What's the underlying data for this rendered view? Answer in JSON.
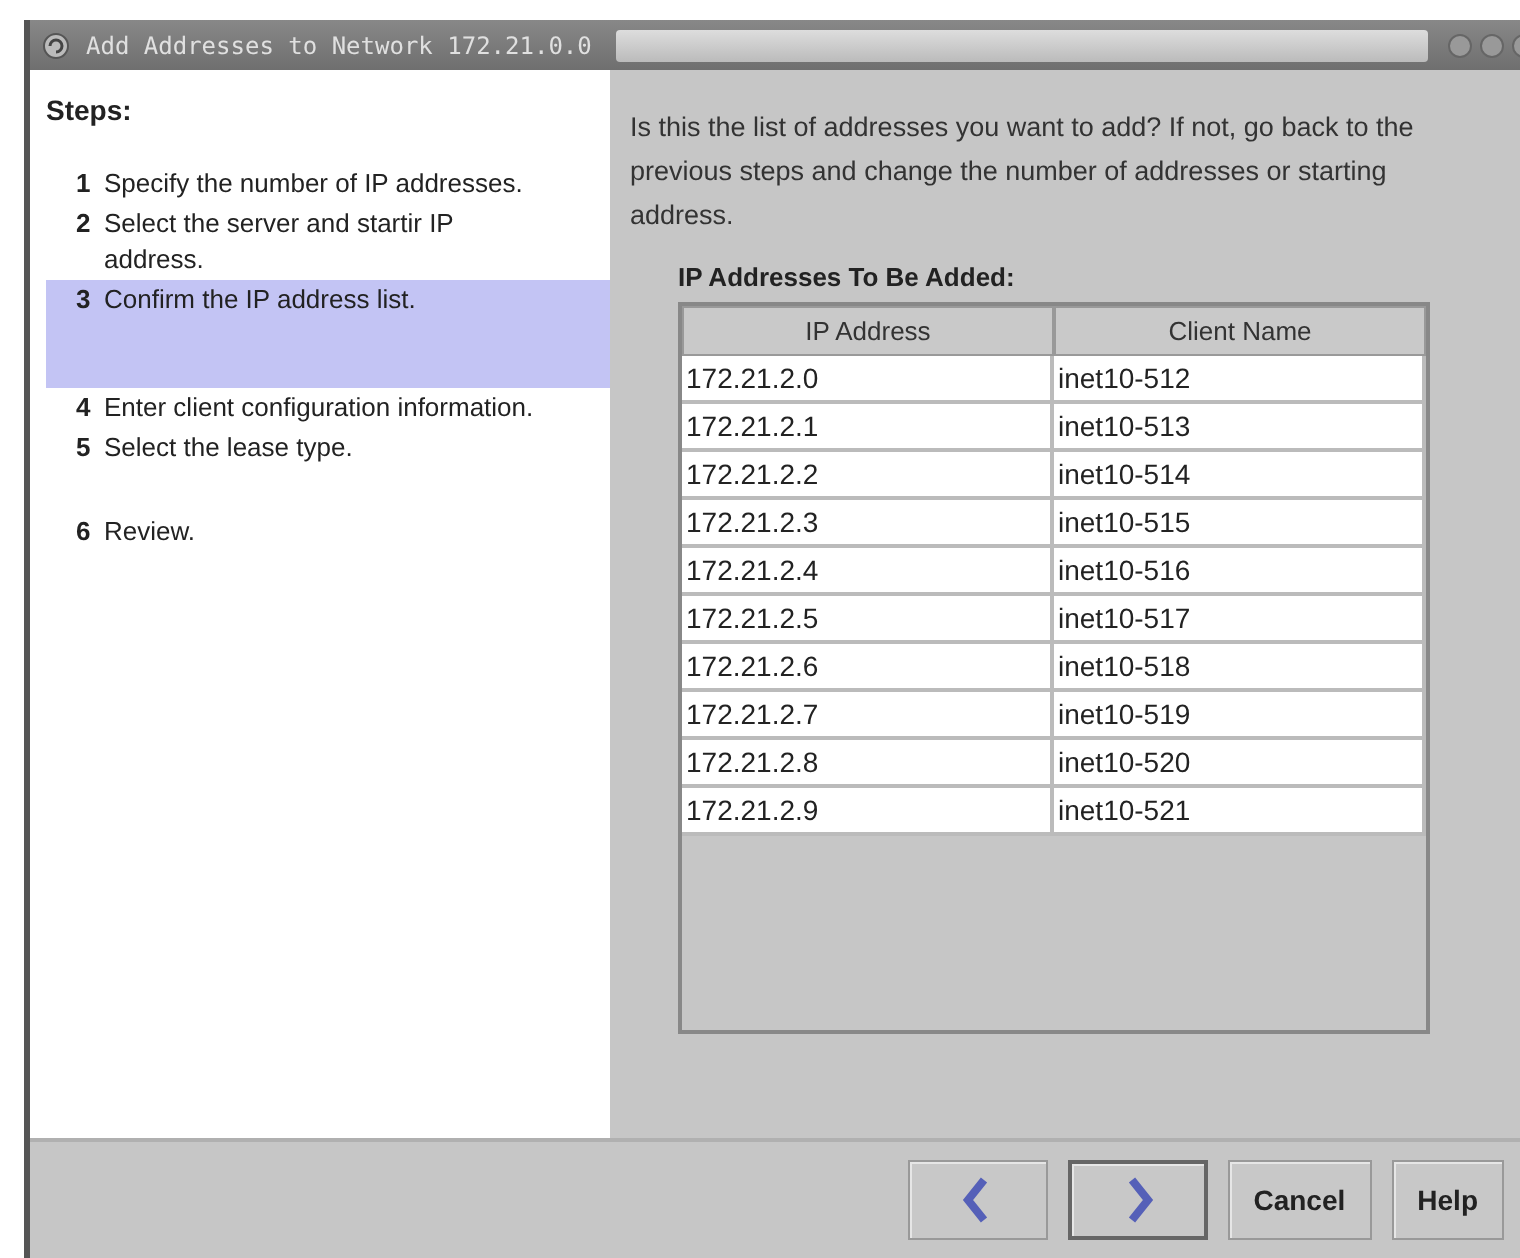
{
  "window": {
    "title": "Add Addresses to Network 172.21.0.0"
  },
  "steps": {
    "heading": "Steps:",
    "items": [
      {
        "number": "1",
        "text": "Specify the number of IP addresses.",
        "selected": false
      },
      {
        "number": "2",
        "text": "Select the server and startir IP address.",
        "selected": false
      },
      {
        "number": "3",
        "text": "Confirm the IP address list.",
        "selected": true
      },
      {
        "number": "4",
        "text": "Enter client configuration information.",
        "selected": false
      },
      {
        "number": "5",
        "text": "Select the lease type.",
        "selected": false
      },
      {
        "number": "6",
        "text": "Review.",
        "selected": false
      }
    ]
  },
  "instructions": "Is this the list of addresses you want to add?  If not, go back to the previous steps and change the number of addresses or starting address.",
  "table": {
    "title": "IP Addresses To Be Added:",
    "columns": [
      "IP Address",
      "Client Name"
    ],
    "rows": [
      [
        "172.21.2.0",
        "inet10-512"
      ],
      [
        "172.21.2.1",
        "inet10-513"
      ],
      [
        "172.21.2.2",
        "inet10-514"
      ],
      [
        "172.21.2.3",
        "inet10-515"
      ],
      [
        "172.21.2.4",
        "inet10-516"
      ],
      [
        "172.21.2.5",
        "inet10-517"
      ],
      [
        "172.21.2.6",
        "inet10-518"
      ],
      [
        "172.21.2.7",
        "inet10-519"
      ],
      [
        "172.21.2.8",
        "inet10-520"
      ],
      [
        "172.21.2.9",
        "inet10-521"
      ]
    ]
  },
  "buttons": [
    {
      "kind": "back"
    },
    {
      "kind": "next"
    },
    {
      "kind": "text",
      "label": "Cancel"
    },
    {
      "kind": "text",
      "label": "Help"
    }
  ]
}
